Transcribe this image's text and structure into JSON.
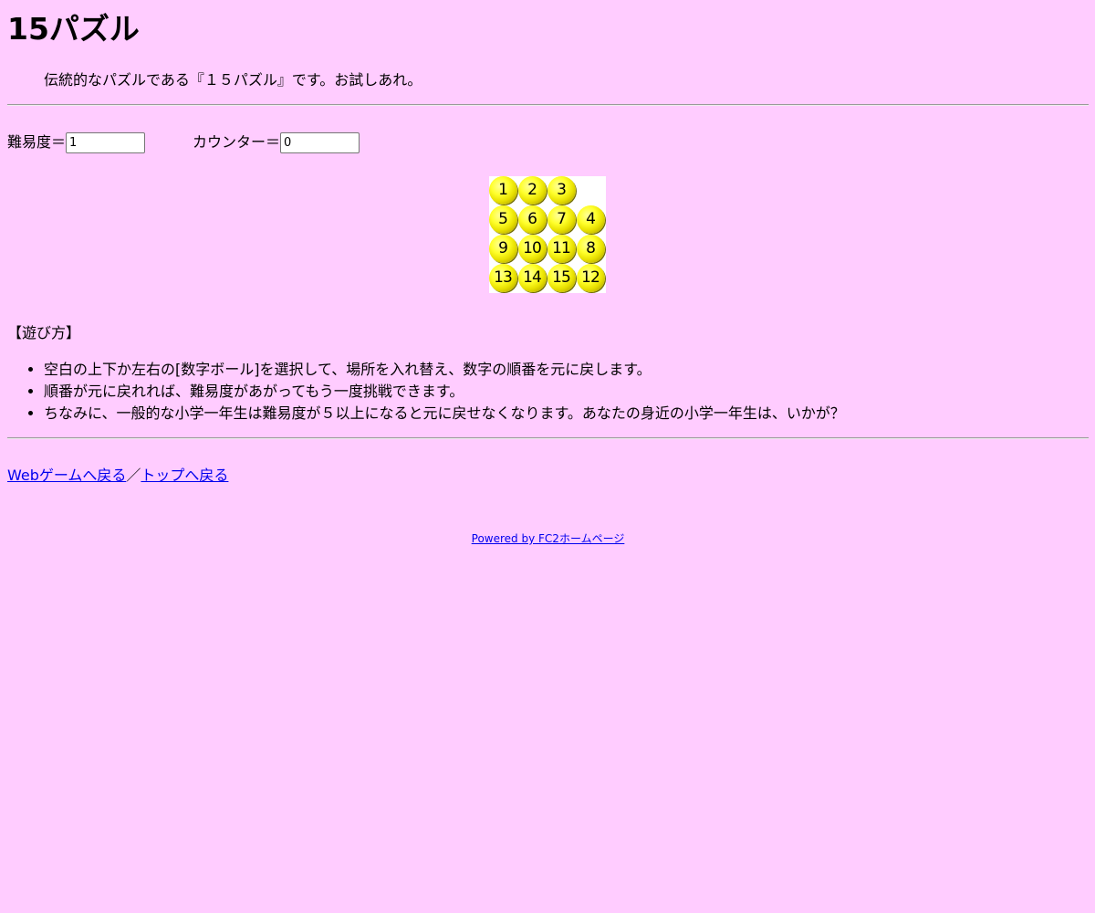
{
  "title": "15パズル",
  "intro": "伝統的なパズルである『１５パズル』です。お試しあれ。",
  "controls": {
    "difficulty_label": "難易度＝",
    "difficulty_value": "1",
    "counter_label": "カウンター＝",
    "counter_value": "0"
  },
  "board": {
    "tiles": [
      "1",
      "2",
      "3",
      "",
      "5",
      "6",
      "7",
      "4",
      "9",
      "10",
      "11",
      "8",
      "13",
      "14",
      "15",
      "12"
    ]
  },
  "howto": {
    "title": "【遊び方】",
    "rules": [
      "空白の上下か左右の[数字ボール]を選択して、場所を入れ替え、数字の順番を元に戻します。",
      "順番が元に戻れれば、難易度があがってもう一度挑戦できます。",
      "ちなみに、一般的な小学一年生は難易度が５以上になると元に戻せなくなります。あなたの身近の小学一年生は、いかが？"
    ]
  },
  "links": {
    "web_games": "Webゲームへ戻る",
    "separator": "／",
    "top": "トップへ戻る"
  },
  "footer": {
    "powered_by": "Powered by FC2ホームページ"
  },
  "colors": {
    "background": "#ffccff",
    "link": "#0000ee",
    "ball": "#ffff2a"
  }
}
